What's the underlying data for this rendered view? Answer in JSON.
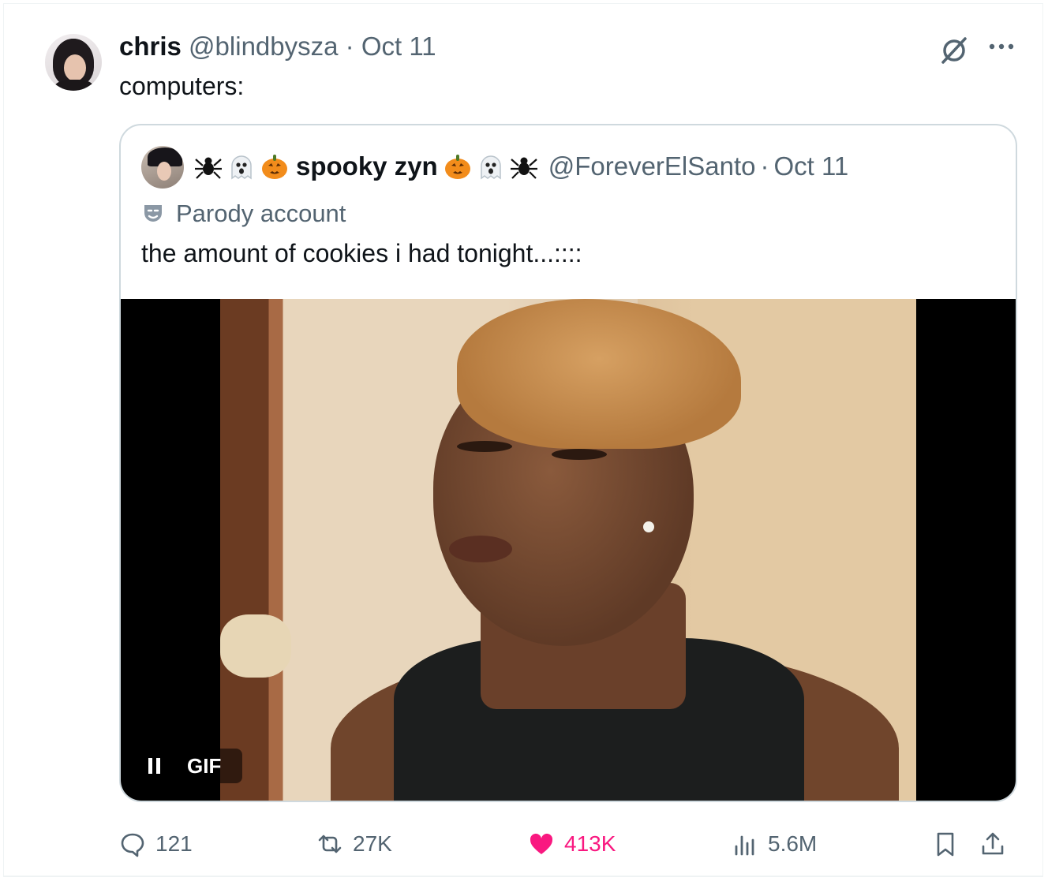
{
  "tweet": {
    "display_name": "chris",
    "handle": "@blindbysza",
    "separator": "·",
    "date": "Oct 11",
    "text": "computers:"
  },
  "quoted": {
    "display_name": "spooky zyn",
    "handle": "@ForeverElSanto",
    "separator": "·",
    "date": "Oct 11",
    "label": "Parody account",
    "text": "the amount of cookies i had tonight...::::",
    "media_badge": "GIF",
    "name_prefix_emoji": [
      "spider-emoji",
      "ghost-emoji",
      "pumpkin-emoji"
    ],
    "name_suffix_emoji": [
      "pumpkin-emoji",
      "ghost-emoji",
      "spider-emoji"
    ]
  },
  "stats": {
    "replies": "121",
    "reposts": "27K",
    "likes": "413K",
    "views": "5.6M"
  },
  "colors": {
    "text": "#0f1419",
    "muted": "#536471",
    "like": "#f91880",
    "border": "#cfd9de"
  }
}
